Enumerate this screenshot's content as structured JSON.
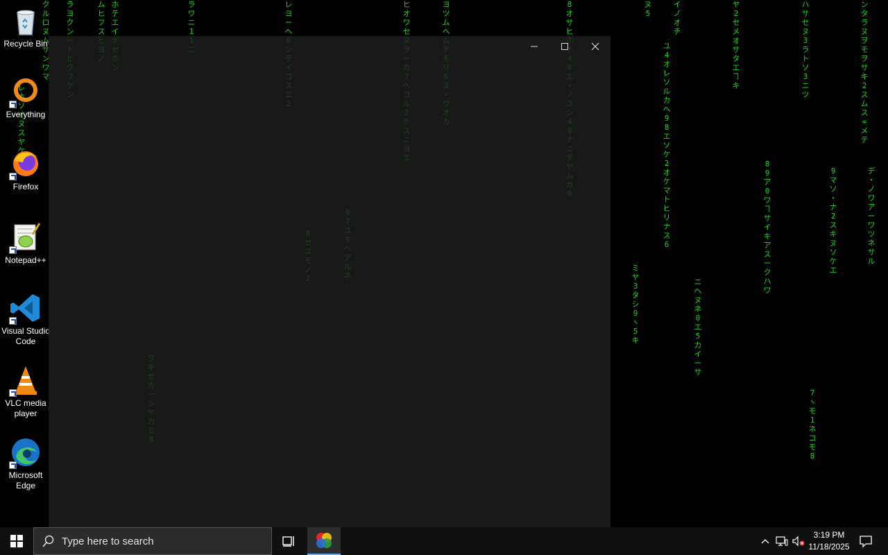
{
  "desktop": {
    "icons": [
      {
        "label": "Recycle Bin",
        "icon": "recycle-bin-icon"
      },
      {
        "label": "Everything",
        "icon": "everything-search-icon"
      },
      {
        "label": "Firefox",
        "icon": "firefox-icon"
      },
      {
        "label": "Notepad++",
        "icon": "notepad-plus-plus-icon"
      },
      {
        "label": "Visual Studio Code",
        "icon": "vscode-icon"
      },
      {
        "label": "VLC media player",
        "icon": "vlc-icon"
      },
      {
        "label": "Microsoft Edge",
        "icon": "edge-icon"
      }
    ],
    "wallpaper": "matrix-rain",
    "rain_color": "#1fd11f"
  },
  "window": {
    "buttons": [
      "minimize-icon",
      "maximize-icon",
      "close-icon"
    ]
  },
  "taskbar": {
    "start_icon": "windows-start-icon",
    "search_placeholder": "Type here to search",
    "task_view_icon": "task-view-icon",
    "pinned_app_icon": "color-wheel-app-icon",
    "tray": {
      "icons": [
        "chevron-up-icon",
        "network-icon",
        "volume-muted-icon"
      ],
      "time": "3:19 PM",
      "date": "11/18/2025",
      "notification_icon": "action-center-icon"
    }
  }
}
